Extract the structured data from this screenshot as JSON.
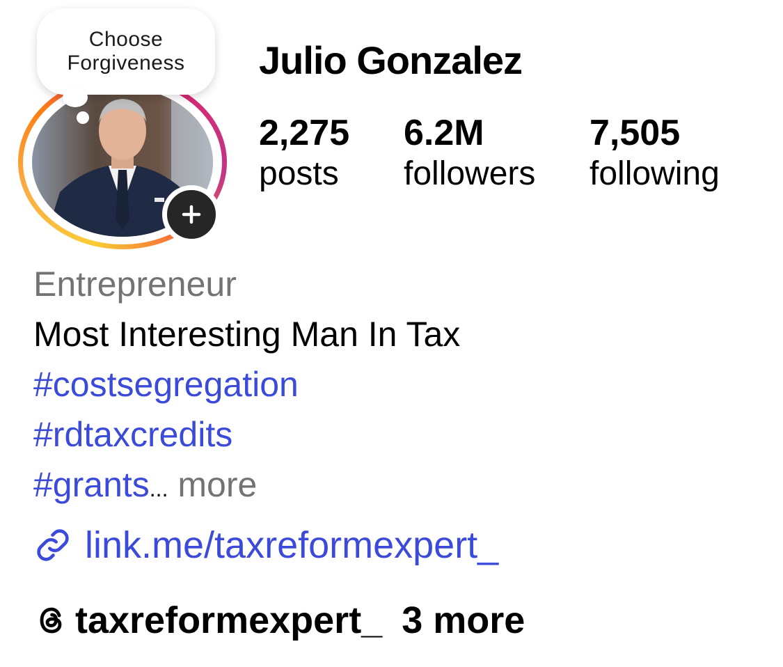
{
  "profile": {
    "name": "Julio Gonzalez",
    "note": {
      "line1": "Choose",
      "line2": "Forgiveness"
    },
    "avatar_icon": "profile-photo",
    "add_story_icon": "plus-icon"
  },
  "stats": {
    "posts": {
      "value": "2,275",
      "label": "posts"
    },
    "followers": {
      "value": "6.2M",
      "label": "followers"
    },
    "following": {
      "value": "7,505",
      "label": "following"
    }
  },
  "bio": {
    "category": "Entrepreneur",
    "text": "Most Interesting Man In Tax",
    "hashtags": [
      "#costsegregation",
      "#rdtaxcredits",
      "#grants"
    ],
    "ellipsis": "...",
    "more_label": "more"
  },
  "link": {
    "icon": "link-icon",
    "text": "link.me/taxreformexpert_"
  },
  "threads": {
    "icon": "threads-icon",
    "handle": "taxreformexpert_",
    "more": "3 more"
  },
  "colors": {
    "hashtag_blue": "#3b4ad9",
    "muted_gray": "#737373",
    "add_button": "#262626"
  }
}
